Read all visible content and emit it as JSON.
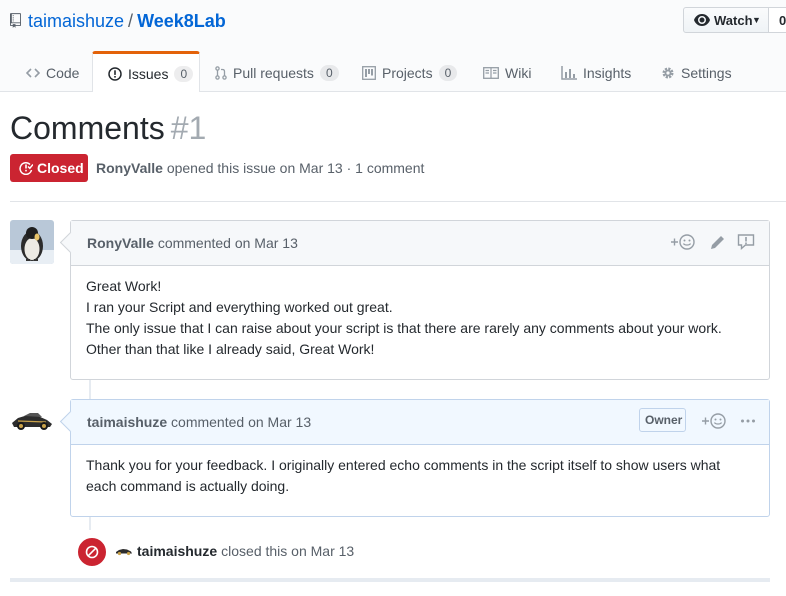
{
  "repo": {
    "owner": "taimaishuze",
    "separator": "/",
    "name": "Week8Lab"
  },
  "watch": {
    "label": "Watch",
    "count": "0"
  },
  "tabs": [
    {
      "label": "Code",
      "icon": "code-icon"
    },
    {
      "label": "Issues",
      "count": "0",
      "icon": "issue-opened-icon"
    },
    {
      "label": "Pull requests",
      "count": "0",
      "icon": "git-pull-request-icon"
    },
    {
      "label": "Projects",
      "count": "0",
      "icon": "project-icon"
    },
    {
      "label": "Wiki",
      "icon": "book-icon"
    },
    {
      "label": "Insights",
      "icon": "graph-icon"
    },
    {
      "label": "Settings",
      "icon": "gear-icon"
    }
  ],
  "issue": {
    "title": "Comments",
    "number": "#1",
    "state": "Closed",
    "author": "RonyValle",
    "opened_text": "opened this issue on Mar 13 · 1 comment"
  },
  "comments": [
    {
      "author": "RonyValle",
      "meta": "commented on Mar 13",
      "body": [
        "Great Work!",
        "I ran your Script and everything worked out great.",
        "The only issue that I can raise about your script is that there are rarely any comments about your work.",
        "Other than that like I already said, Great Work!"
      ]
    },
    {
      "author": "taimaishuze",
      "meta": "commented on Mar 13",
      "badge": "Owner",
      "body": [
        "Thank you for your feedback. I originally entered echo comments in the script itself to show users what each command is actually doing."
      ]
    }
  ],
  "event": {
    "actor": "taimaishuze",
    "text": "closed this on Mar 13"
  },
  "colors": {
    "closed_red": "#cb2431",
    "link_blue": "#0366d6",
    "tab_accent": "#e36209"
  }
}
